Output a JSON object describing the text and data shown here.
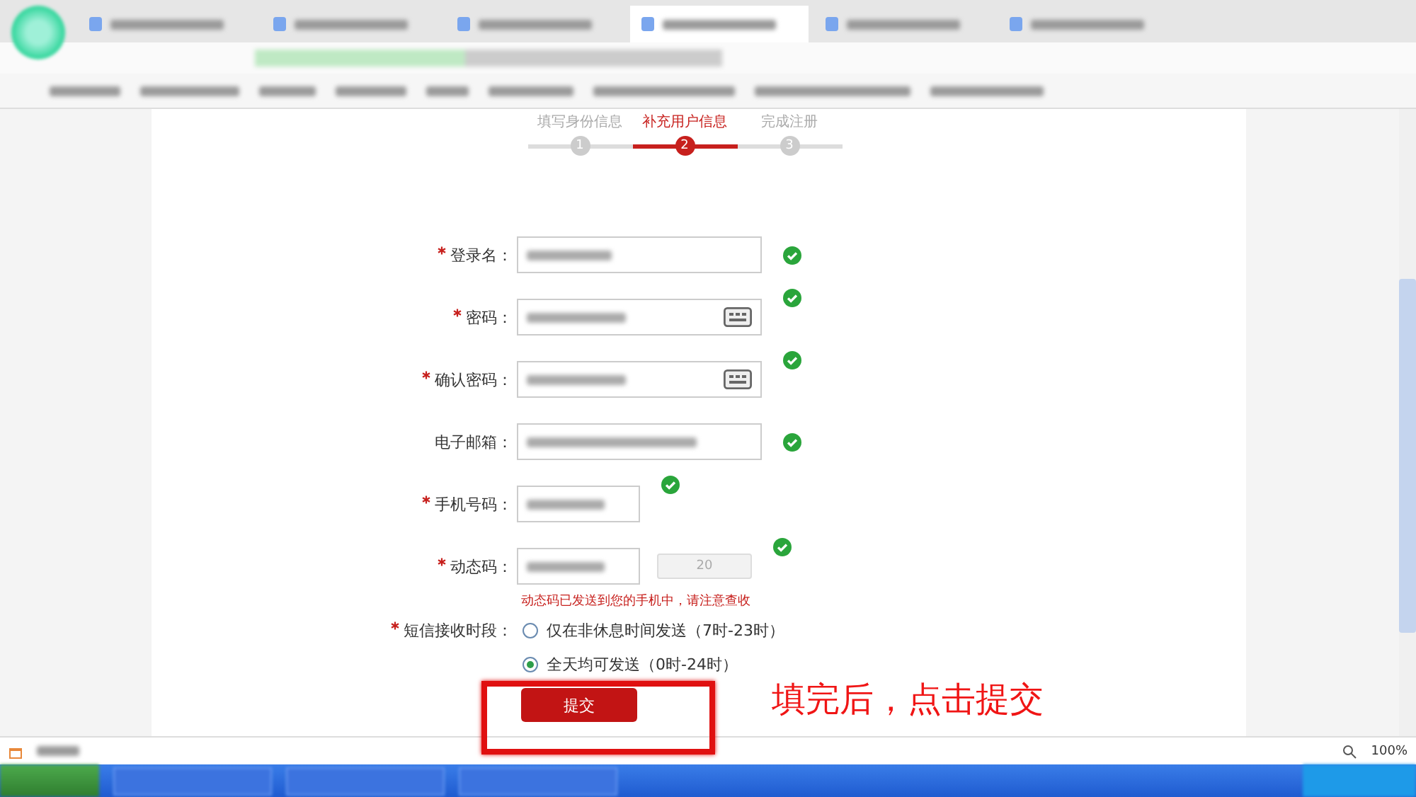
{
  "browser": {
    "tabs": [
      {
        "selected": false
      },
      {
        "selected": false
      },
      {
        "selected": false
      },
      {
        "selected": true
      },
      {
        "selected": false
      },
      {
        "selected": false
      }
    ]
  },
  "steps": [
    {
      "label": "填写身份信息",
      "number": "1",
      "selected": false
    },
    {
      "label": "补充用户信息",
      "number": "2",
      "selected": true
    },
    {
      "label": "完成注册",
      "number": "3",
      "selected": false
    }
  ],
  "form": {
    "fields": [
      {
        "label": "登录名：",
        "required": true,
        "kind": "text",
        "valid": true
      },
      {
        "label": "密码：",
        "required": true,
        "kind": "password",
        "valid": true
      },
      {
        "label": "确认密码：",
        "required": true,
        "kind": "password",
        "valid": true
      },
      {
        "label": "电子邮箱：",
        "required": false,
        "kind": "email",
        "valid": true
      },
      {
        "label": "手机号码：",
        "required": true,
        "kind": "phone",
        "valid": true
      },
      {
        "label": "动态码：",
        "required": true,
        "kind": "code",
        "valid": true,
        "button": "20"
      }
    ],
    "message": "动态码已发送到您的手机中，请注意查收",
    "sms": {
      "label": "短信接收时段：",
      "required": true,
      "options": [
        {
          "label": "仅在非休息时间发送（7时-23时）",
          "selected": false
        },
        {
          "label": "全天均可发送（0时-24时）",
          "selected": true
        }
      ]
    },
    "submit": "提交"
  },
  "annotation": "填完后，点击提交",
  "status_bar": {
    "zoom": "100%"
  }
}
